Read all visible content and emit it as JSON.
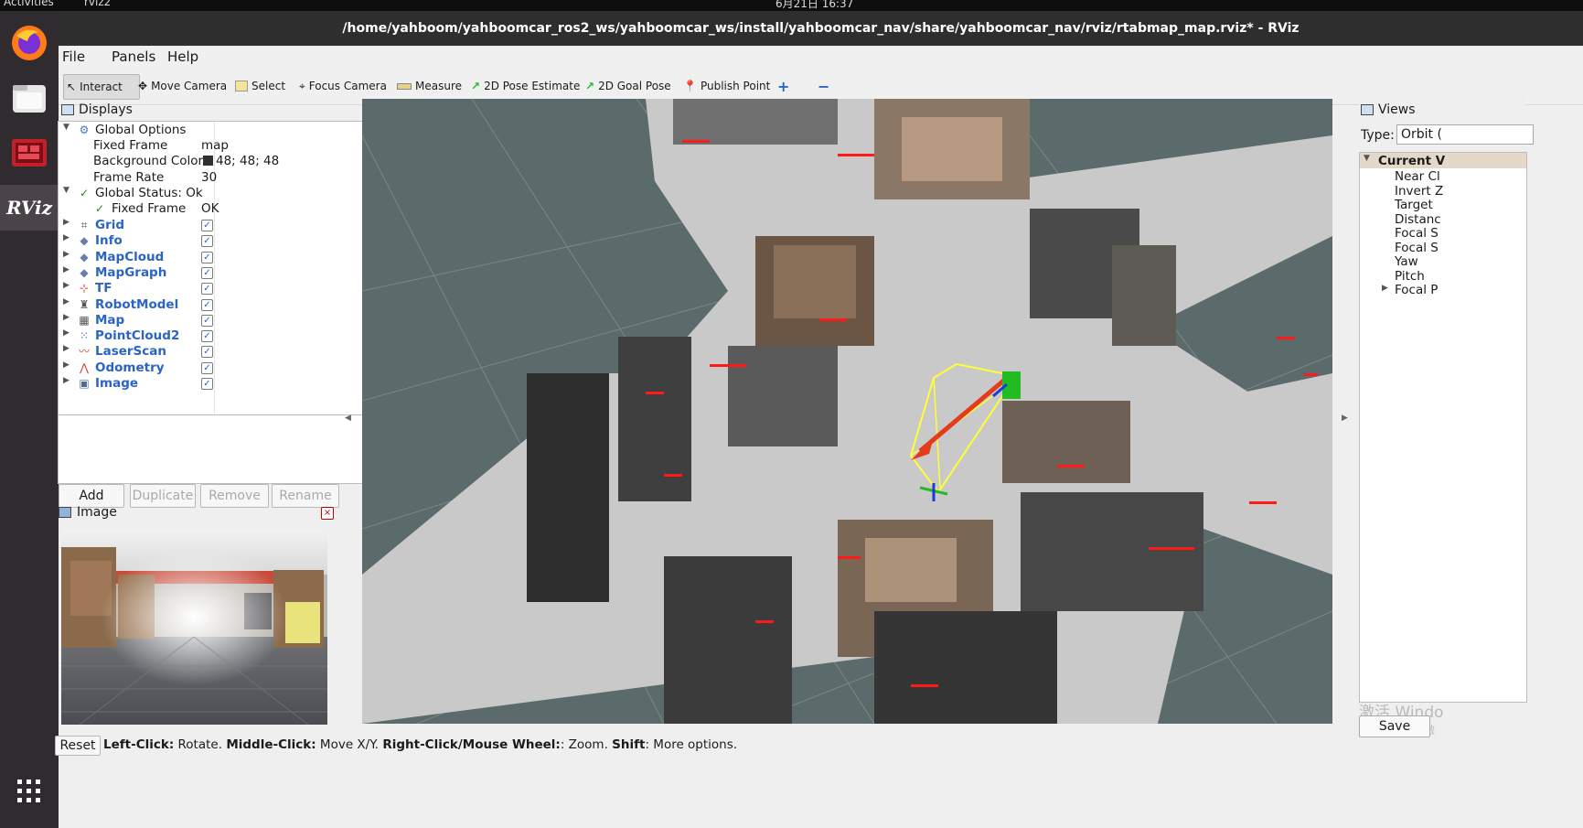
{
  "topbar": {
    "activities": "Activities",
    "app_menu": "rviz2",
    "clock": "6月21日 16:37"
  },
  "dock": {
    "apps": [
      "firefox",
      "files",
      "app-launcher",
      "rviz"
    ],
    "rviz_label": "RViz"
  },
  "window": {
    "title": "/home/yahboom/yahboomcar_ros2_ws/yahboomcar_ws/install/yahboomcar_nav/share/yahboomcar_nav/rviz/rtabmap_map.rviz* - RViz"
  },
  "menu": {
    "file": "File",
    "panels": "Panels",
    "help": "Help"
  },
  "toolbar": {
    "interact": "Interact",
    "move_camera": "Move Camera",
    "select": "Select",
    "focus_camera": "Focus Camera",
    "measure": "Measure",
    "pose_estimate": "2D Pose Estimate",
    "goal_pose": "2D Goal Pose",
    "publish_point": "Publish Point"
  },
  "displays": {
    "title": "Displays",
    "global_options": "Global Options",
    "fixed_frame_label": "Fixed Frame",
    "fixed_frame_value": "map",
    "bg_color_label": "Background Color",
    "bg_color_value": "48; 48; 48",
    "frame_rate_label": "Frame Rate",
    "frame_rate_value": "30",
    "global_status": "Global Status: Ok",
    "status_fixed_frame": "Fixed Frame",
    "status_fixed_frame_value": "OK",
    "items": [
      {
        "label": "Grid",
        "icon": "grid-icon",
        "checked": true
      },
      {
        "label": "Info",
        "icon": "info-icon",
        "checked": true
      },
      {
        "label": "MapCloud",
        "icon": "cloud-icon",
        "checked": true
      },
      {
        "label": "MapGraph",
        "icon": "graph-icon",
        "checked": true
      },
      {
        "label": "TF",
        "icon": "tf-axes-icon",
        "checked": true
      },
      {
        "label": "RobotModel",
        "icon": "robot-icon",
        "checked": true
      },
      {
        "label": "Map",
        "icon": "map-icon",
        "checked": true
      },
      {
        "label": "PointCloud2",
        "icon": "pointcloud-icon",
        "checked": true
      },
      {
        "label": "LaserScan",
        "icon": "laserscan-icon",
        "checked": true
      },
      {
        "label": "Odometry",
        "icon": "odometry-icon",
        "checked": true
      },
      {
        "label": "Image",
        "icon": "image-icon",
        "checked": true
      }
    ],
    "buttons": {
      "add": "Add",
      "duplicate": "Duplicate",
      "remove": "Remove",
      "rename": "Rename"
    }
  },
  "image_panel": {
    "title": "Image"
  },
  "views": {
    "title": "Views",
    "type_label": "Type:",
    "type_value": "Orbit (",
    "current_view": "Current V",
    "props": [
      "Near Cl",
      "Invert Z",
      "Target",
      "Distanc",
      "Focal S",
      "Focal S",
      "Yaw",
      "Pitch",
      "Focal P"
    ],
    "save": "Save",
    "watermark_line1": "激活 Windo",
    "watermark_line2": "转到\"设置\"以激"
  },
  "status": {
    "reset": "Reset",
    "left_click": "Left-Click:",
    "left_click_text": " Rotate. ",
    "middle_click": "Middle-Click:",
    "middle_click_text": " Move X/Y. ",
    "right_click": "Right-Click/Mouse Wheel:",
    "right_click_text": ": Zoom. ",
    "shift": "Shift",
    "shift_text": ": More options."
  },
  "colors": {
    "accent": "#2a64c4",
    "viewport_bg": "#5b6a6a",
    "map_free": "#c8c8c8",
    "laser": "#ff1a1a",
    "goal_pose": "#ff3b00",
    "path": "#ffff00"
  }
}
